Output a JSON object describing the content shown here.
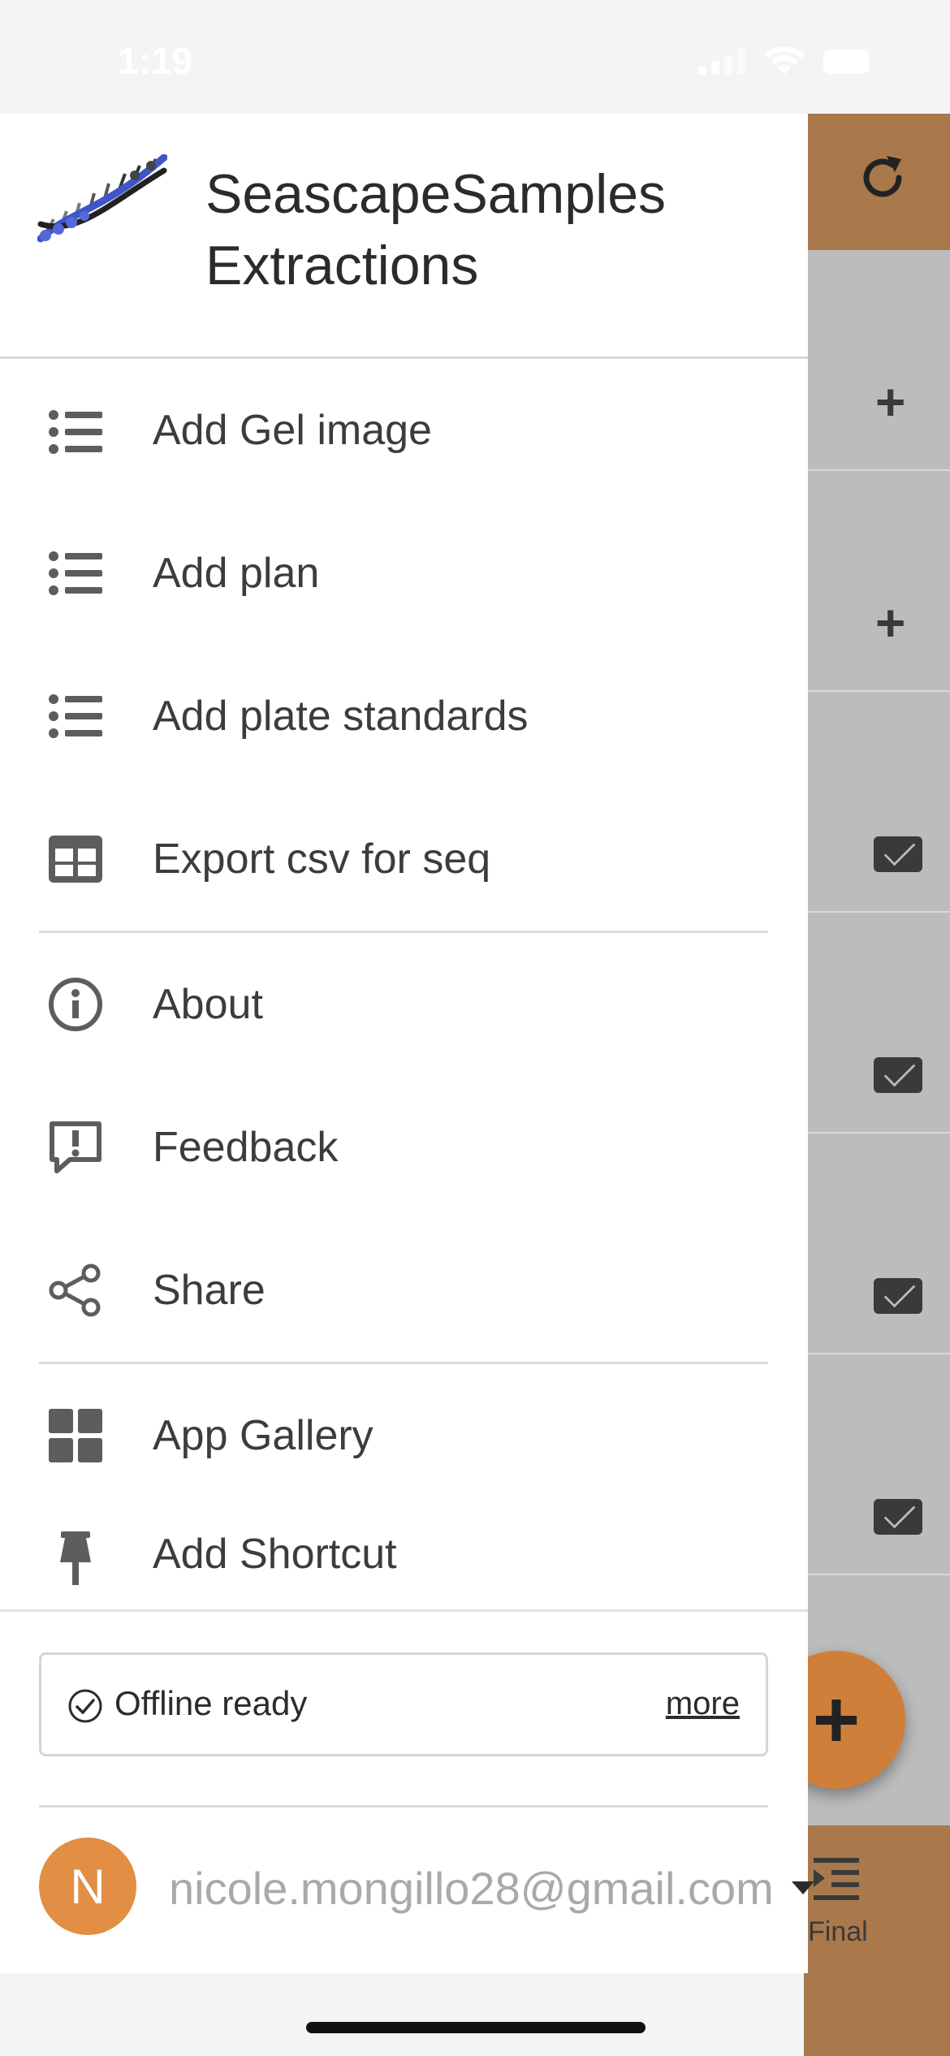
{
  "status_bar": {
    "time": "1:19"
  },
  "app": {
    "title": "SeascapeSamples Extractions",
    "logo": "dna-helix-logo"
  },
  "menu": {
    "items": [
      {
        "label": "Add Gel image",
        "icon": "list-icon"
      },
      {
        "label": "Add plan",
        "icon": "list-icon"
      },
      {
        "label": "Add plate standards",
        "icon": "list-icon"
      },
      {
        "label": "Export csv for seq",
        "icon": "table-icon"
      },
      {
        "label": "About",
        "icon": "info-icon"
      },
      {
        "label": "Feedback",
        "icon": "feedback-icon"
      },
      {
        "label": "Share",
        "icon": "share-icon"
      },
      {
        "label": "App Gallery",
        "icon": "grid-icon"
      },
      {
        "label": "Add Shortcut",
        "icon": "pin-icon"
      }
    ]
  },
  "footer": {
    "offline_label": "Offline ready",
    "offline_more": "more",
    "avatar_initial": "N",
    "email": "nicole.mongillo28@gmail.com"
  },
  "background": {
    "bottom_tab_label": "Final",
    "accent_color": "#a9784b",
    "fab_color": "#cf7f3a"
  }
}
